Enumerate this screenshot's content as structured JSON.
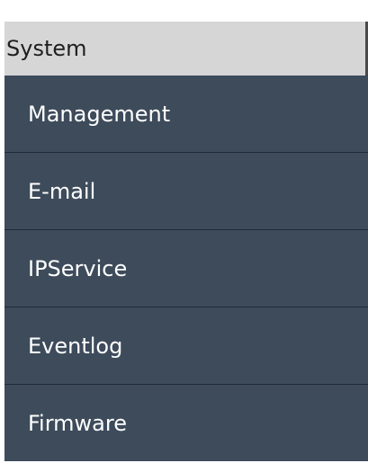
{
  "nav": {
    "header_label": "System",
    "items": [
      {
        "label": "Management"
      },
      {
        "label": "E-mail"
      },
      {
        "label": "IPService"
      },
      {
        "label": "Eventlog"
      },
      {
        "label": "Firmware"
      }
    ]
  },
  "colors": {
    "header_bg": "#d6d6d6",
    "menu_bg": "#3d4b5b",
    "menu_text": "#ffffff",
    "divider": "#1f2a35"
  }
}
